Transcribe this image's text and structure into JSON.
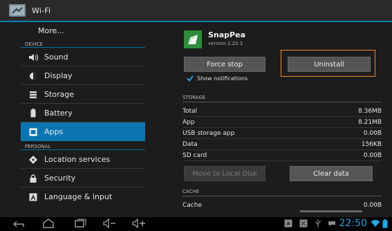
{
  "actionbar": {
    "title": "Wi-Fi"
  },
  "left": {
    "more_label": "More...",
    "device_header": "DEVICE",
    "personal_header": "PERSONAL",
    "items": [
      {
        "label": "Sound",
        "icon": "speaker-icon"
      },
      {
        "label": "Display",
        "icon": "brightness-icon"
      },
      {
        "label": "Storage",
        "icon": "storage-icon"
      },
      {
        "label": "Battery",
        "icon": "battery-icon"
      },
      {
        "label": "Apps",
        "icon": "apps-icon",
        "selected": true
      },
      {
        "label": "Location services",
        "icon": "location-icon"
      },
      {
        "label": "Security",
        "icon": "lock-icon"
      },
      {
        "label": "Language & input",
        "icon": "keyboard-icon"
      }
    ]
  },
  "app": {
    "name": "SnapPea",
    "version": "version 2.20.3",
    "force_stop": "Force stop",
    "uninstall": "Uninstall",
    "show_notifications": "Show notifications",
    "show_notifications_checked": true
  },
  "storage": {
    "header": "STORAGE",
    "rows": [
      {
        "label": "Total",
        "value": "8.36MB"
      },
      {
        "label": "App",
        "value": "8.21MB"
      },
      {
        "label": "USB storage app",
        "value": "0.00B"
      },
      {
        "label": "Data",
        "value": "156KB"
      },
      {
        "label": "SD card",
        "value": "0.00B"
      }
    ],
    "move_button": "Move to Local Disk",
    "clear_data": "Clear data"
  },
  "cache": {
    "header": "CACHE",
    "rows": [
      {
        "label": "Cache",
        "value": "0.00B"
      }
    ]
  },
  "statusbar": {
    "time": "22:50"
  },
  "colors": {
    "accent": "#0b75b1",
    "highlight": "#f08a2c",
    "clock": "#27a8e0"
  }
}
